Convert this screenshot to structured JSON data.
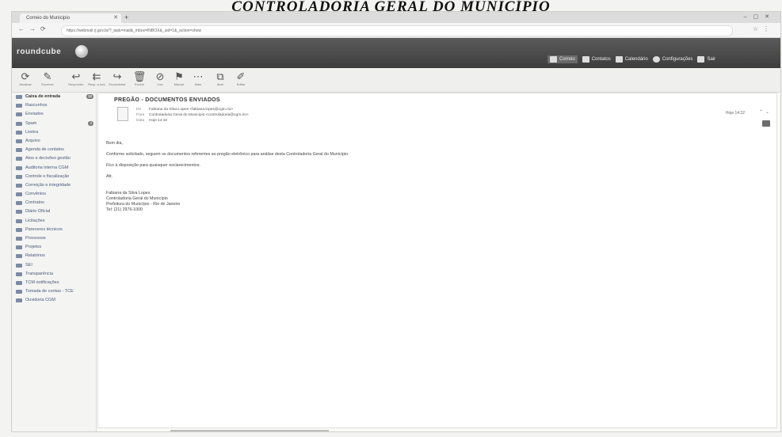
{
  "document": {
    "header": "CONTROLADORIA GERAL DO MUNICÍPIO"
  },
  "browser": {
    "tab_title": "Correio do Municipio",
    "url": "https://webmail.rj.gov.br/?_task=mail&_mbox=INBOX&_uid=1&_action=show"
  },
  "app": {
    "logo": "roundcube",
    "topnav": [
      {
        "label": "Correio",
        "icon": "mail-icon"
      },
      {
        "label": "Contatos",
        "icon": "contacts-icon"
      },
      {
        "label": "Calendário",
        "icon": "calendar-icon"
      },
      {
        "label": "Configurações",
        "icon": "gear-icon"
      },
      {
        "label": "Sair",
        "icon": "logout-icon"
      }
    ]
  },
  "toolbar": [
    {
      "label": "Atualizar",
      "icon": "refresh-icon",
      "glyph": "⟳"
    },
    {
      "label": "Escrever",
      "icon": "compose-icon",
      "glyph": "✎"
    },
    {
      "label": "Responder",
      "icon": "reply-icon",
      "glyph": "↩"
    },
    {
      "label": "Resp. a todos",
      "icon": "reply-all-icon",
      "glyph": "⇇"
    },
    {
      "label": "Encaminhar",
      "icon": "forward-icon",
      "glyph": "↪"
    },
    {
      "label": "Excluir",
      "icon": "trash-icon",
      "glyph": "🗑"
    },
    {
      "label": "Lixo",
      "icon": "junk-icon",
      "glyph": "⊘"
    },
    {
      "label": "Marcar",
      "icon": "flag-icon",
      "glyph": "⚑"
    },
    {
      "label": "Mais",
      "icon": "more-icon",
      "glyph": "⋯"
    },
    {
      "label": "Abrir",
      "icon": "open-icon",
      "glyph": "⧉"
    },
    {
      "label": "Editar",
      "icon": "edit-icon",
      "glyph": "✐"
    }
  ],
  "folders": [
    {
      "label": "Caixa de entrada",
      "count": "12"
    },
    {
      "label": "Rascunhos",
      "count": ""
    },
    {
      "label": "Enviados",
      "count": ""
    },
    {
      "label": "Spam",
      "count": "3"
    },
    {
      "label": "Lixeira",
      "count": ""
    },
    {
      "label": "Arquivo",
      "count": ""
    },
    {
      "label": "Agenda de contatos",
      "count": ""
    },
    {
      "label": "Atos e decisões gestão",
      "count": ""
    },
    {
      "label": "Auditoria interna CGM",
      "count": ""
    },
    {
      "label": "Controle e fiscalização",
      "count": ""
    },
    {
      "label": "Correição e integridade",
      "count": ""
    },
    {
      "label": "Convênios",
      "count": ""
    },
    {
      "label": "Contratos",
      "count": ""
    },
    {
      "label": "Diário Oficial",
      "count": ""
    },
    {
      "label": "Licitações",
      "count": ""
    },
    {
      "label": "Pareceres técnicos",
      "count": ""
    },
    {
      "label": "Processos",
      "count": ""
    },
    {
      "label": "Projetos",
      "count": ""
    },
    {
      "label": "Relatórios",
      "count": ""
    },
    {
      "label": "SEI",
      "count": ""
    },
    {
      "label": "Transparência",
      "count": ""
    },
    {
      "label": "TCM notificações",
      "count": ""
    },
    {
      "label": "Tomada de contas - TCE",
      "count": ""
    },
    {
      "label": "Ouvidoria CGM",
      "count": ""
    }
  ],
  "message": {
    "subject": "PREGÃO - DOCUMENTOS ENVIADOS",
    "from_label": "De",
    "from": "Fabiana da Silva Lopes <fabiana.lopes@cgm.rio>",
    "to_label": "Para",
    "to": "Controladoria Geral do Município <controladoria@cgm.rio>",
    "date_label": "Data",
    "date": "Hoje 14:32",
    "date_short": "Hoje 14:32",
    "body": [
      "Bom dia,",
      "",
      "Conforme solicitado, seguem os documentos referentes ao pregão eletrônico para análise desta Controladoria Geral do Município.",
      "",
      "Fico à disposição para quaisquer esclarecimentos.",
      "",
      "Att.",
      "",
      "",
      "Fabiana da Silva Lopes",
      "Controladoria Geral do Município",
      "Prefeitura do Município - Rio de Janeiro",
      "Tel: (21) 2976-1000"
    ]
  }
}
